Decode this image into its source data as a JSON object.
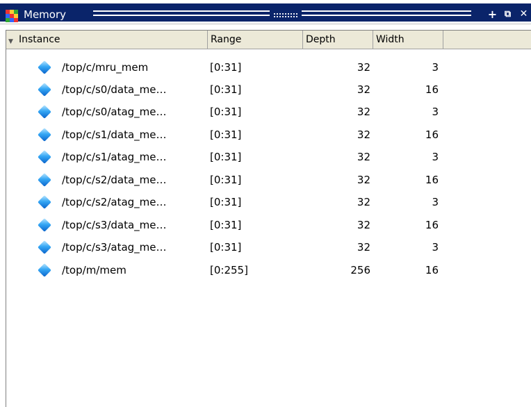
{
  "window": {
    "title": "Memory",
    "icons": {
      "app": "memory-grid-icon",
      "add": "plus-icon",
      "undock": "undock-icon",
      "close": "close-icon"
    },
    "buttons": {
      "add": "+",
      "undock": "⧉",
      "close": "✕"
    }
  },
  "table": {
    "columns": [
      "Instance",
      "Range",
      "Depth",
      "Width"
    ],
    "rows": [
      {
        "instance": "/top/c/mru_mem",
        "range": "[0:31]",
        "depth": "32",
        "width": "3"
      },
      {
        "instance": "/top/c/s0/data_me…",
        "range": "[0:31]",
        "depth": "32",
        "width": "16"
      },
      {
        "instance": "/top/c/s0/atag_me…",
        "range": "[0:31]",
        "depth": "32",
        "width": "3"
      },
      {
        "instance": "/top/c/s1/data_me…",
        "range": "[0:31]",
        "depth": "32",
        "width": "16"
      },
      {
        "instance": "/top/c/s1/atag_me…",
        "range": "[0:31]",
        "depth": "32",
        "width": "3"
      },
      {
        "instance": "/top/c/s2/data_me…",
        "range": "[0:31]",
        "depth": "32",
        "width": "16"
      },
      {
        "instance": "/top/c/s2/atag_me…",
        "range": "[0:31]",
        "depth": "32",
        "width": "3"
      },
      {
        "instance": "/top/c/s3/data_me…",
        "range": "[0:31]",
        "depth": "32",
        "width": "16"
      },
      {
        "instance": "/top/c/s3/atag_me…",
        "range": "[0:31]",
        "depth": "32",
        "width": "3"
      },
      {
        "instance": "/top/m/mem",
        "range": "[0:255]",
        "depth": "256",
        "width": "16"
      }
    ]
  },
  "colors": {
    "titlebar": "#0a246a",
    "header": "#ece9d8",
    "diamond": "#35a7f5"
  }
}
